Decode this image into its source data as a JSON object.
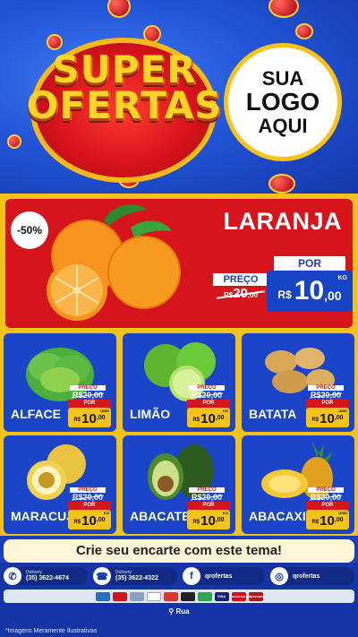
{
  "header": {
    "title_line1": "SUPER",
    "title_line2": "OFERTAS",
    "logo_line1": "SUA",
    "logo_line2": "LOGO",
    "logo_line3": "AQUI"
  },
  "featured": {
    "badge": "-50%",
    "name": "LARANJA",
    "old_label": "PREÇO",
    "old_currency": "R$",
    "old_price_int": "20",
    "old_price_dec": ",00",
    "new_label": "POR",
    "currency": "R$",
    "price_int": "10",
    "price_dec": ",00",
    "unit": "KG"
  },
  "products": [
    {
      "name": "ALFACE",
      "old_label": "PREÇO",
      "old_price": "R$20,00",
      "new_label": "POR",
      "currency": "R$",
      "price_int": "10",
      "price_dec": ",00",
      "unit": "UNID"
    },
    {
      "name": "LIMÃO",
      "old_label": "PREÇO",
      "old_price": "R$20,00",
      "new_label": "POR",
      "currency": "R$",
      "price_int": "10",
      "price_dec": ",00",
      "unit": "KG"
    },
    {
      "name": "BATATA",
      "old_label": "PREÇO",
      "old_price": "R$20,00",
      "new_label": "POR",
      "currency": "R$",
      "price_int": "10",
      "price_dec": ",00",
      "unit": "UNID"
    },
    {
      "name": "MARACUJÁ",
      "old_label": "PREÇO",
      "old_price": "R$20,00",
      "new_label": "POR",
      "currency": "R$",
      "price_int": "10",
      "price_dec": ",00",
      "unit": "KG"
    },
    {
      "name": "ABACATE",
      "old_label": "PREÇO",
      "old_price": "R$20,00",
      "new_label": "POR",
      "currency": "R$",
      "price_int": "10",
      "price_dec": ",00",
      "unit": "KG"
    },
    {
      "name": "ABACAXI",
      "old_label": "PREÇO",
      "old_price": "R$20,00",
      "new_label": "POR",
      "currency": "R$",
      "price_int": "10",
      "price_dec": ",00",
      "unit": "UNID"
    }
  ],
  "cta": "Crie seu encarte com este tema!",
  "footer": {
    "whatsapp_label": "Delivery",
    "whatsapp_phone": "(35) 3622-4674",
    "phone_label": "Delivery",
    "phone_number": "(35) 3622-4322",
    "facebook": "qrofertas",
    "instagram": "qrofertas",
    "payments": [
      "VISA",
      "Mastercard",
      "Hipercard"
    ],
    "address": "Rua",
    "disclaimer": "*Imagens Meramente Ilustrativas"
  },
  "colors": {
    "brand_blue": "#1a45c8",
    "brand_red": "#d5141c",
    "brand_yellow": "#f3c21a"
  },
  "icons": [
    "whatsapp-icon",
    "phone-icon",
    "facebook-icon",
    "instagram-icon",
    "location-pin-icon"
  ]
}
